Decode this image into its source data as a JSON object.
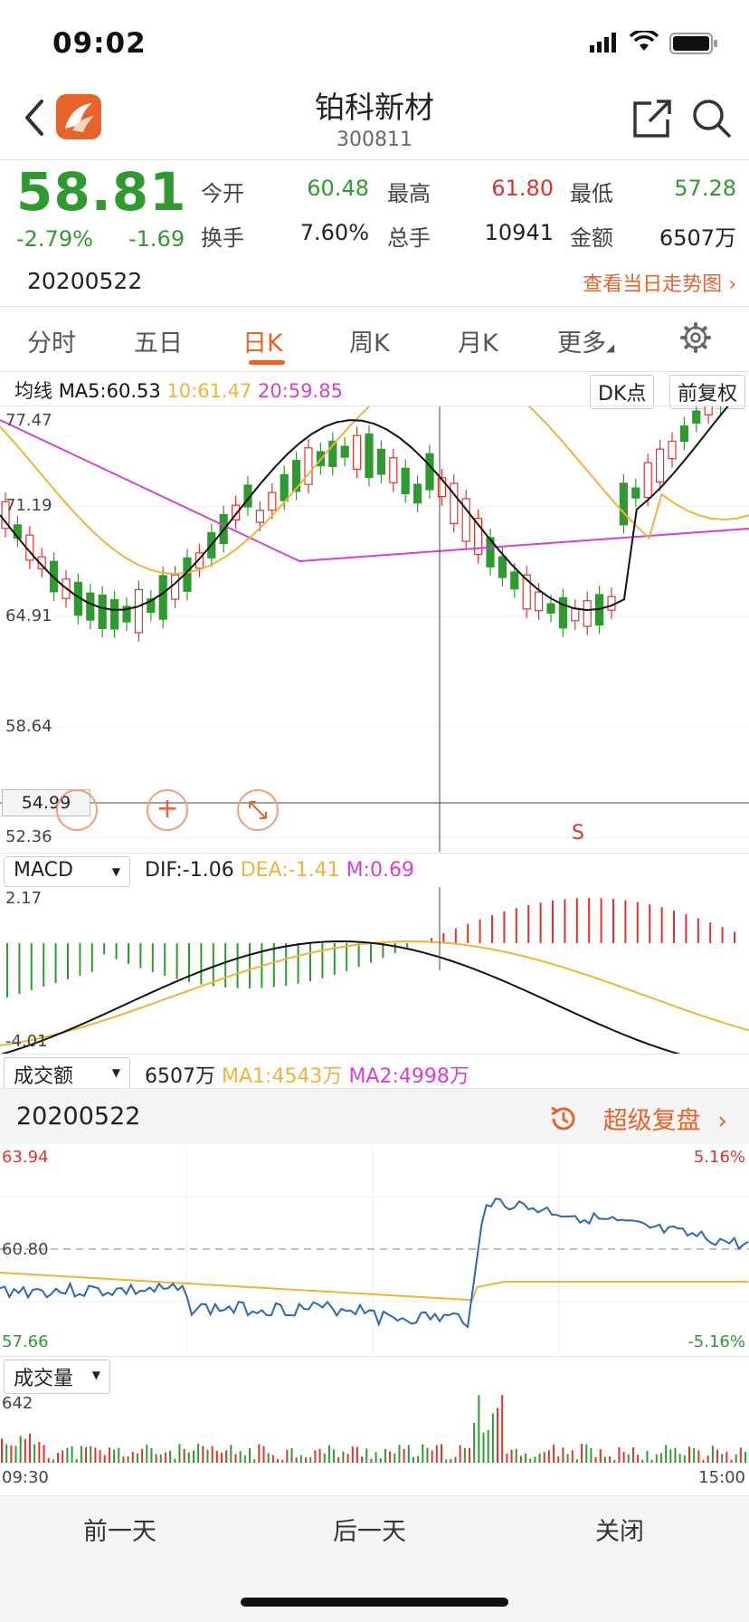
{
  "status_bar": {
    "time": "09:02"
  },
  "header": {
    "title": "铂科新材",
    "code": "300811"
  },
  "quote": {
    "price": "58.81",
    "change_pct": "-2.79%",
    "change": "-1.69",
    "fields": [
      {
        "label": "今开",
        "value": "60.48",
        "tone": "green"
      },
      {
        "label": "最高",
        "value": "61.80",
        "tone": "red"
      },
      {
        "label": "最低",
        "value": "57.28",
        "tone": "green"
      },
      {
        "label": "换手",
        "value": "7.60%",
        "tone": "dark"
      },
      {
        "label": "总手",
        "value": "10941",
        "tone": "dark"
      },
      {
        "label": "金额",
        "value": "6507万",
        "tone": "dark"
      }
    ],
    "date": "20200522",
    "view_today_link": "查看当日走势图"
  },
  "tabs": [
    {
      "label": "分时"
    },
    {
      "label": "五日"
    },
    {
      "label": "日K",
      "active": true
    },
    {
      "label": "周K"
    },
    {
      "label": "月K"
    },
    {
      "label": "更多"
    }
  ],
  "kline": {
    "ma_title": "均线",
    "ma5": "MA5:60.53",
    "ma10": "10:61.47",
    "ma20": "20:59.85",
    "dk_button": "DK点",
    "adjust_button": "前复权",
    "y_labels": [
      "77.47",
      "71.19",
      "64.91",
      "58.64",
      "52.36"
    ],
    "crosshair_price": "54.99",
    "signal_marker": "S"
  },
  "macd": {
    "selector": "MACD",
    "dif": "DIF:-1.06",
    "dea": "DEA:-1.41",
    "m": "M:0.69",
    "y_top": "2.17",
    "y_bottom": "-4.01"
  },
  "turnover": {
    "selector": "成交额",
    "value": "6507万",
    "ma1": "MA1:4543万",
    "ma2": "MA2:4998万"
  },
  "replay": {
    "date": "20200522",
    "button": "超级复盘"
  },
  "intraday": {
    "price_top": "63.94",
    "price_mid": "60.80",
    "price_bottom": "57.66",
    "pct_top": "5.16%",
    "pct_bottom": "-5.16%"
  },
  "volume": {
    "selector": "成交量",
    "y_top": "642",
    "time_start": "09:30",
    "time_end": "15:00"
  },
  "footer": {
    "prev_day": "前一天",
    "next_day": "后一天",
    "close": "关闭"
  },
  "colors": {
    "up": "#e1332d",
    "down": "#2f9a2f",
    "accent": "#e8632b",
    "ma5": "#111111",
    "ma10": "#f0b23a",
    "ma20": "#d43fd8"
  }
}
